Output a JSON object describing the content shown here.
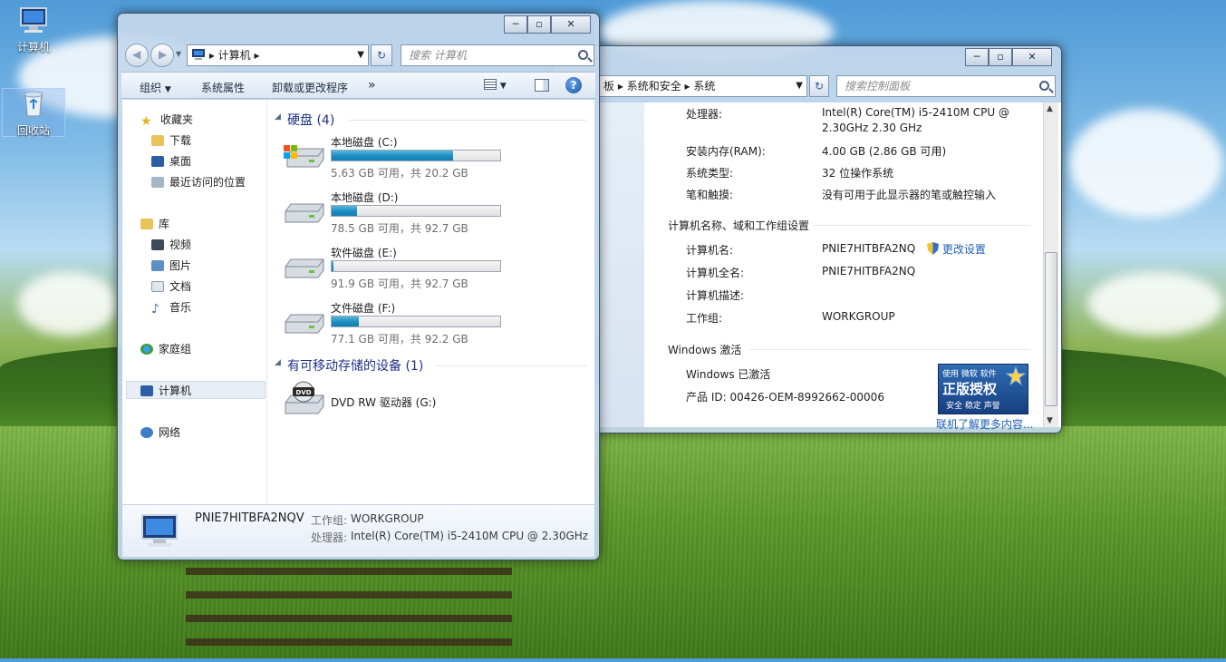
{
  "desktop": {
    "icons": [
      {
        "label": "计算机"
      },
      {
        "label": "回收站"
      }
    ]
  },
  "explorer": {
    "address": {
      "root": "计算机"
    },
    "search_placeholder": "搜索 计算机",
    "toolbar": {
      "organize": "组织",
      "system_properties": "系统属性",
      "uninstall": "卸载或更改程序",
      "more": "»"
    },
    "nav": {
      "favorites": "收藏夹",
      "downloads": "下载",
      "desktop": "桌面",
      "recent": "最近访问的位置",
      "libraries": "库",
      "videos": "视频",
      "pictures": "图片",
      "documents": "文档",
      "music": "音乐",
      "homegroup": "家庭组",
      "computer": "计算机",
      "network": "网络"
    },
    "groups": {
      "hard_disks": "硬盘 (4)",
      "removable": "有可移动存储的设备 (1)"
    },
    "drives": [
      {
        "name": "本地磁盘 (C:)",
        "size": "5.63 GB 可用，共 20.2 GB",
        "used": 0.72
      },
      {
        "name": "本地磁盘 (D:)",
        "size": "78.5 GB 可用，共 92.7 GB",
        "used": 0.15
      },
      {
        "name": "软件磁盘 (E:)",
        "size": "91.9 GB 可用，共 92.7 GB",
        "used": 0.01
      },
      {
        "name": "文件磁盘 (F:)",
        "size": "77.1 GB 可用，共 92.2 GB",
        "used": 0.16
      }
    ],
    "dvd": {
      "name": "DVD RW 驱动器 (G:)",
      "icon_text": "DVD"
    },
    "details": {
      "computer_name": "PNIE7HITBFA2NQV",
      "workgroup_label": "工作组:",
      "workgroup": "WORKGROUP",
      "processor_label": "处理器:",
      "processor": "Intel(R) Core(TM) i5-2410M CPU @ 2.30GHz"
    }
  },
  "system": {
    "address": {
      "part0": "板",
      "part1": "系统和安全",
      "part2": "系统"
    },
    "search_placeholder": "搜索控制面板",
    "rows": {
      "processor_label": "处理器:",
      "processor_val1": "Intel(R) Core(TM) i5-2410M CPU @",
      "processor_val2": "2.30GHz   2.30 GHz",
      "ram_label": "安装内存(RAM):",
      "ram_val": "4.00 GB (2.86 GB 可用)",
      "type_label": "系统类型:",
      "type_val": "32 位操作系统",
      "pen_label": "笔和触摸:",
      "pen_val": "没有可用于此显示器的笔或触控输入"
    },
    "name_section": {
      "title": "计算机名称、域和工作组设置",
      "name_label": "计算机名:",
      "name_val": "PNIE7HITBFA2NQ",
      "change_link": "更改设置",
      "fullname_label": "计算机全名:",
      "fullname_val": "PNIE7HITBFA2NQ",
      "desc_label": "计算机描述:",
      "workgroup_label": "工作组:",
      "workgroup_val": "WORKGROUP"
    },
    "activation": {
      "title": "Windows 激活",
      "status": "Windows 已激活",
      "product_id": "产品 ID: 00426-OEM-8992662-00006",
      "badge_top": "使用 微软 软件",
      "badge_main": "正版授权",
      "badge_sub": "安全 稳定 声誉",
      "learn_more": "联机了解更多内容..."
    }
  },
  "colors": {
    "accent_blue": "#1e3287",
    "link": "#1f5fb8",
    "bar_fill": "#1c8cc0"
  }
}
